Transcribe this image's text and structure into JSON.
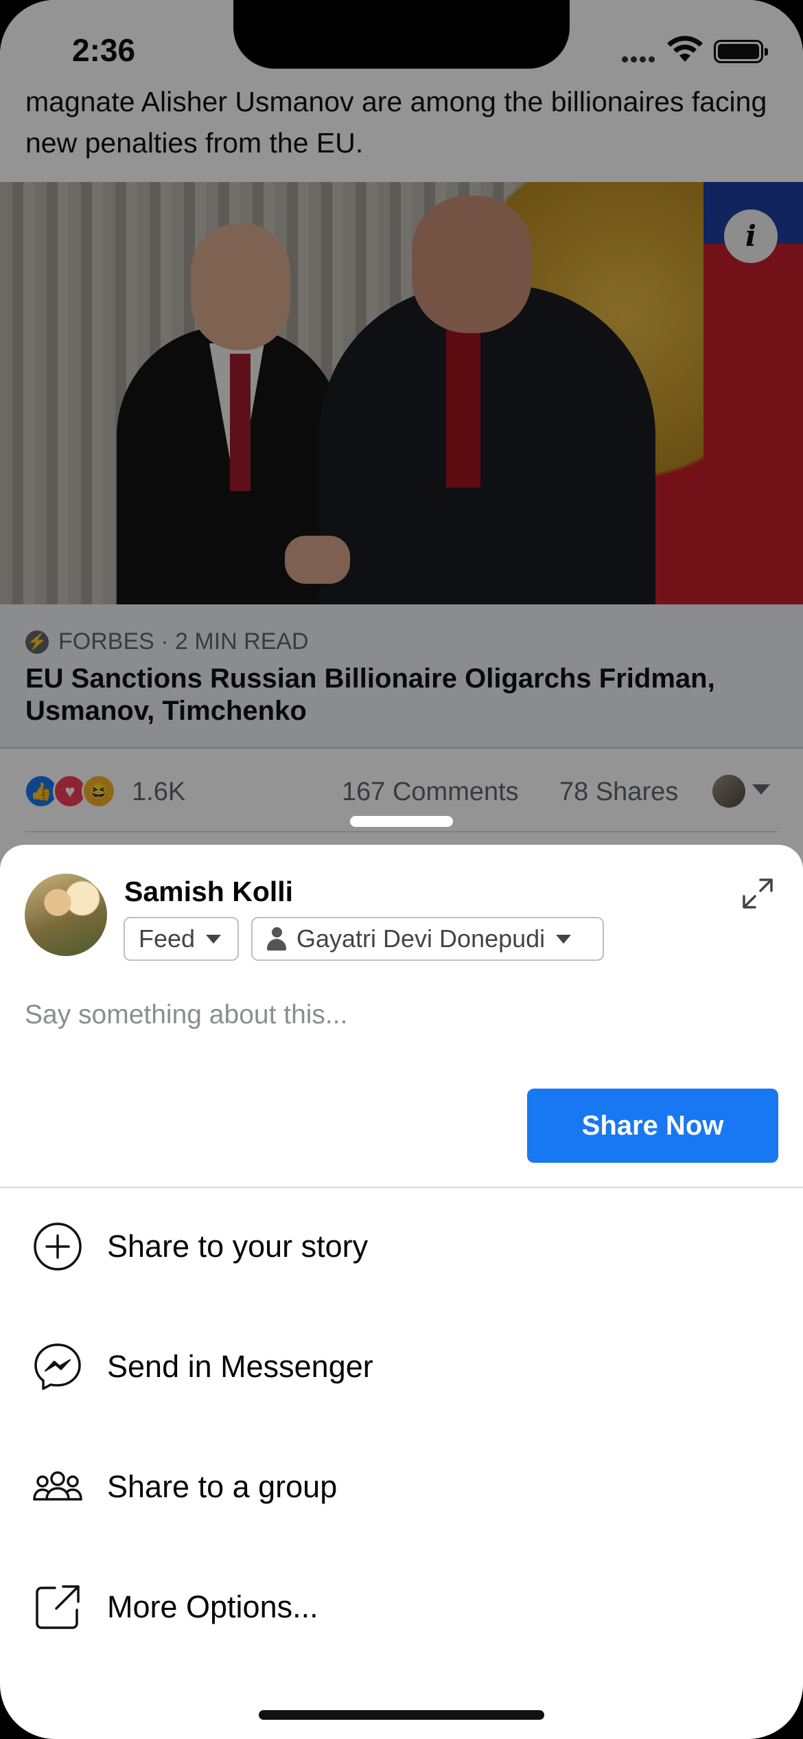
{
  "status_bar": {
    "time": "2:36"
  },
  "post": {
    "snippet": "magnate Alisher Usmanov are among the billionaires facing new penalties from the EU.",
    "link": {
      "source": "FORBES · 2 MIN READ",
      "headline": "EU Sanctions Russian Billionaire Oligarchs Fridman, Usmanov, Timchenko"
    },
    "reactions_count": "1.6K",
    "comments": "167 Comments",
    "shares": "78 Shares"
  },
  "share_sheet": {
    "user_name": "Samish Kolli",
    "destination_chip": "Feed",
    "audience_chip": "Gayatri Devi Donepudi",
    "composer_placeholder": "Say something about this...",
    "share_now_label": "Share Now",
    "options": [
      {
        "label": "Share to your story",
        "icon": "add-circle-icon"
      },
      {
        "label": "Send in Messenger",
        "icon": "messenger-icon"
      },
      {
        "label": "Share to a group",
        "icon": "group-icon"
      },
      {
        "label": "More Options...",
        "icon": "external-share-icon"
      }
    ]
  },
  "colors": {
    "accent": "#1877f2",
    "text_primary": "#050505",
    "text_secondary": "#65676b",
    "overlay": "rgba(0,0,0,0.42)"
  }
}
